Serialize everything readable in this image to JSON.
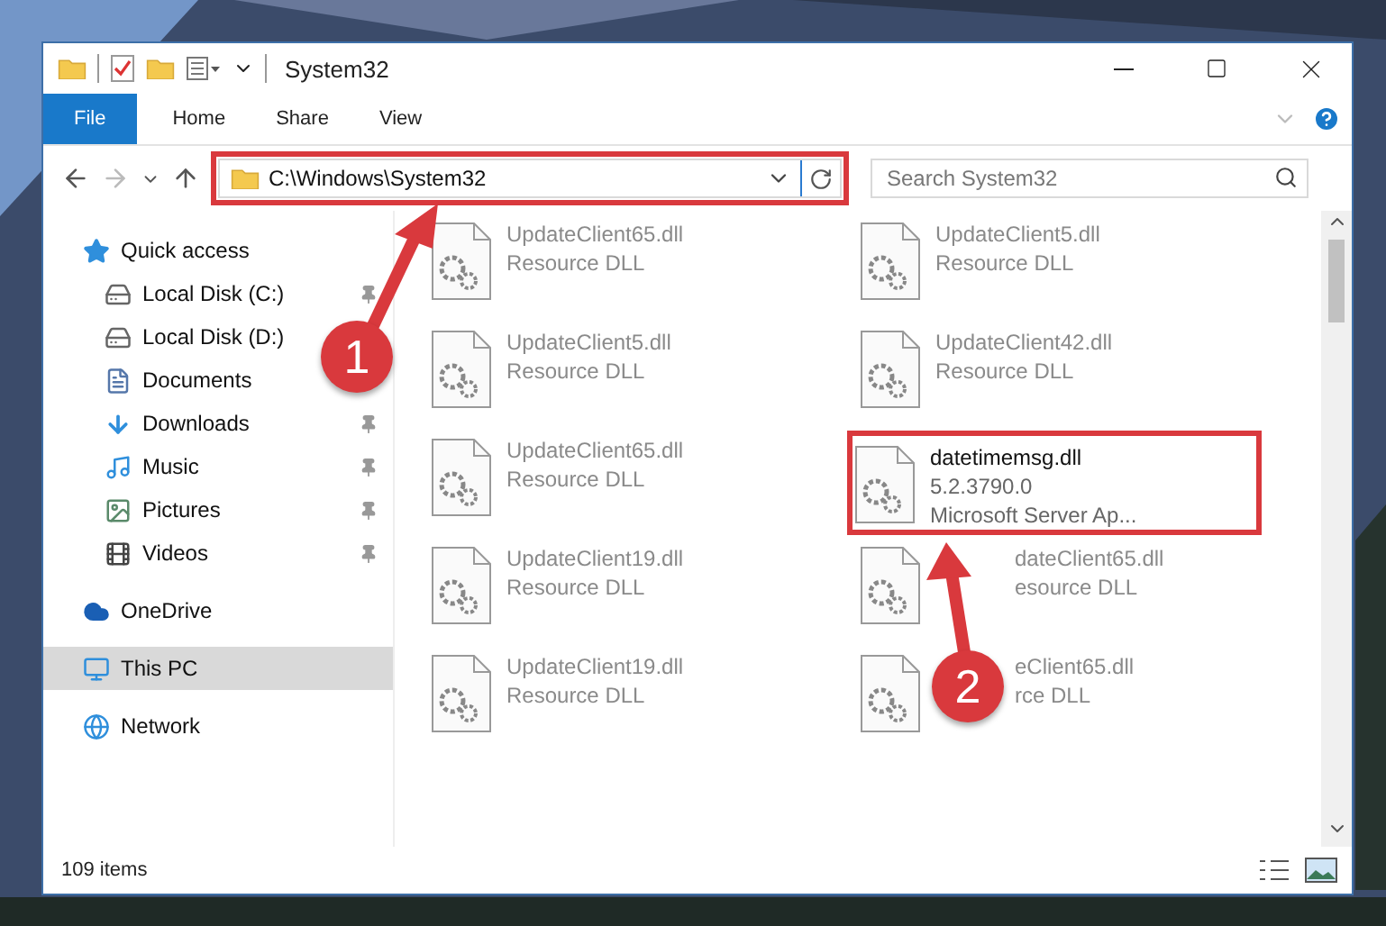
{
  "window": {
    "title": "System32"
  },
  "ribbon_tabs": [
    {
      "label": "File",
      "kind": "file"
    },
    {
      "label": "Home",
      "kind": "tab"
    },
    {
      "label": "Share",
      "kind": "tab"
    },
    {
      "label": "View",
      "kind": "tab"
    }
  ],
  "address": {
    "path": "C:\\Windows\\System32",
    "highlighted": true
  },
  "search": {
    "placeholder": "Search System32"
  },
  "sidebar": {
    "items": [
      {
        "label": "Quick access",
        "selected": false,
        "children": [
          {
            "label": "Local Disk (C:)",
            "pinned": true,
            "selected": false
          },
          {
            "label": "Local Disk (D:)",
            "selected": false
          },
          {
            "label": "Documents",
            "selected": false
          },
          {
            "label": "Downloads",
            "pinned": true,
            "selected": false
          },
          {
            "label": "Music",
            "pinned": true,
            "selected": false
          },
          {
            "label": "Pictures",
            "pinned": true,
            "selected": false
          },
          {
            "label": "Videos",
            "pinned": true,
            "selected": false
          }
        ]
      },
      {
        "label": "OneDrive",
        "selected": false
      },
      {
        "label": "This PC",
        "selected": true
      },
      {
        "label": "Network",
        "selected": false
      }
    ]
  },
  "files": [
    {
      "name": "UpdateClient65.dll",
      "lines": [
        "Resource DLL"
      ],
      "dimmed": true,
      "highlighted": false,
      "partly_hidden": false
    },
    {
      "name": "UpdateClient5.dll",
      "lines": [
        "Resource DLL"
      ],
      "dimmed": true,
      "highlighted": false,
      "partly_hidden": false
    },
    {
      "name": "UpdateClient5.dll",
      "lines": [
        "Resource DLL"
      ],
      "dimmed": true,
      "highlighted": false,
      "partly_hidden": false
    },
    {
      "name": "UpdateClient42.dll",
      "lines": [
        "Resource DLL"
      ],
      "dimmed": true,
      "highlighted": false,
      "partly_hidden": false
    },
    {
      "name": "UpdateClient65.dll",
      "lines": [
        "Resource DLL"
      ],
      "dimmed": true,
      "highlighted": false,
      "partly_hidden": false
    },
    {
      "name": "datetimemsg.dll",
      "lines": [
        "5.2.3790.0",
        "Microsoft Server Ap..."
      ],
      "dimmed": false,
      "highlighted": true,
      "partly_hidden": false
    },
    {
      "name": "UpdateClient19.dll",
      "lines": [
        "Resource DLL"
      ],
      "dimmed": true,
      "highlighted": false,
      "partly_hidden": false
    },
    {
      "name": "dateClient65.dll",
      "lines": [
        "esource DLL"
      ],
      "dimmed": true,
      "highlighted": false,
      "partly_hidden": true
    },
    {
      "name": "UpdateClient19.dll",
      "lines": [
        "Resource DLL"
      ],
      "dimmed": true,
      "highlighted": false,
      "partly_hidden": false
    },
    {
      "name": "eClient65.dll",
      "lines": [
        "rce DLL"
      ],
      "dimmed": true,
      "highlighted": false,
      "partly_hidden": true
    }
  ],
  "status_bar": {
    "count": "109 items"
  },
  "annotations": [
    {
      "number": "1"
    },
    {
      "number": "2"
    }
  ]
}
